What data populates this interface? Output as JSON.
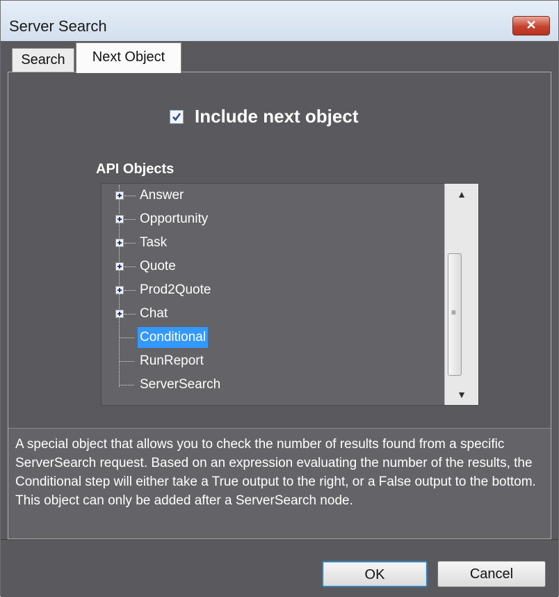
{
  "window": {
    "title": "Server Search",
    "close_glyph": "✕"
  },
  "tabs": [
    {
      "label": "Search",
      "active": false
    },
    {
      "label": "Next Object",
      "active": true
    }
  ],
  "include_checkbox": {
    "label": "Include next object",
    "checked": true
  },
  "api_objects": {
    "label": "API Objects",
    "items": [
      {
        "label": "Answer",
        "expandable": true,
        "selected": false
      },
      {
        "label": "Opportunity",
        "expandable": true,
        "selected": false
      },
      {
        "label": "Task",
        "expandable": true,
        "selected": false
      },
      {
        "label": "Quote",
        "expandable": true,
        "selected": false
      },
      {
        "label": "Prod2Quote",
        "expandable": true,
        "selected": false
      },
      {
        "label": "Chat",
        "expandable": true,
        "selected": false
      },
      {
        "label": "Conditional",
        "expandable": false,
        "selected": true
      },
      {
        "label": "RunReport",
        "expandable": false,
        "selected": false
      },
      {
        "label": "ServerSearch",
        "expandable": false,
        "selected": false
      }
    ]
  },
  "description": "A special object that allows you to check the number of results found from a specific ServerSearch request. Based on an expression evaluating the number of the results, the Conditional step will either take a True output to the right, or a False output to the bottom. This object can only be added after a ServerSearch node.",
  "buttons": {
    "ok": "OK",
    "cancel": "Cancel"
  },
  "colors": {
    "background": "#5a595d",
    "selection": "#3399ff",
    "close_button": "#c5432f"
  }
}
